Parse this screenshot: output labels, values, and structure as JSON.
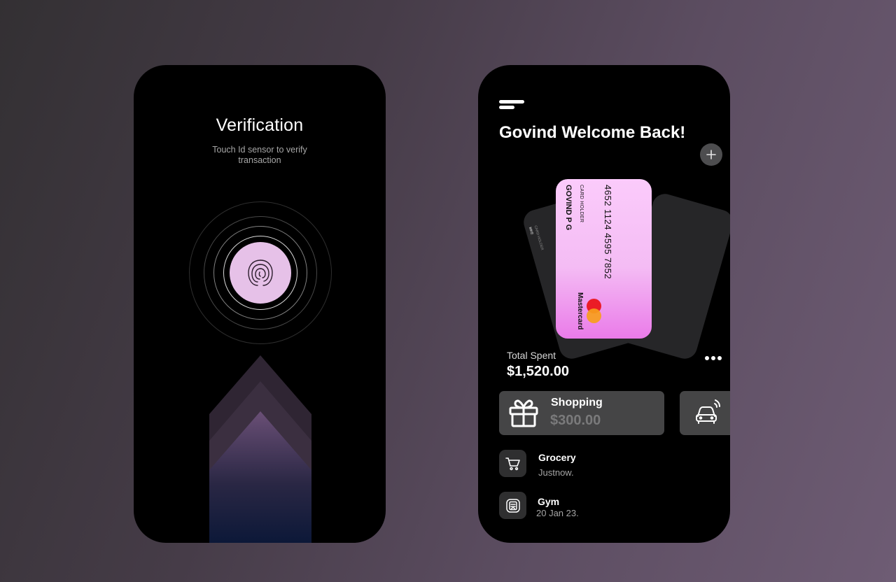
{
  "verification": {
    "title": "Verification",
    "subtitle": "Touch Id sensor to verify transaction",
    "fingerprint_icon": "fingerprint-icon",
    "accent_color": "#e6c1e8"
  },
  "dashboard": {
    "welcome": "Govind Welcome Back!",
    "card": {
      "holder_label": "CARD HOLDER",
      "holder_name": "GOVIND P G",
      "number": "4652  1124  4595 7852",
      "brand": "Mastercard",
      "back_holder_label": "CARD HOLDER",
      "back_holder_name": "MKE"
    },
    "total_spent_label": "Total Spent",
    "total_spent_value": "$1,520.00",
    "categories": [
      {
        "name": "Shopping",
        "amount": "$300.00",
        "icon": "gift-icon"
      },
      {
        "icon": "car-icon"
      }
    ],
    "transactions": [
      {
        "name": "Grocery",
        "time": "Justnow.",
        "icon": "cart-icon"
      },
      {
        "name": "Gym",
        "time": "20 Jan 23.",
        "icon": "receipt-icon"
      }
    ]
  }
}
